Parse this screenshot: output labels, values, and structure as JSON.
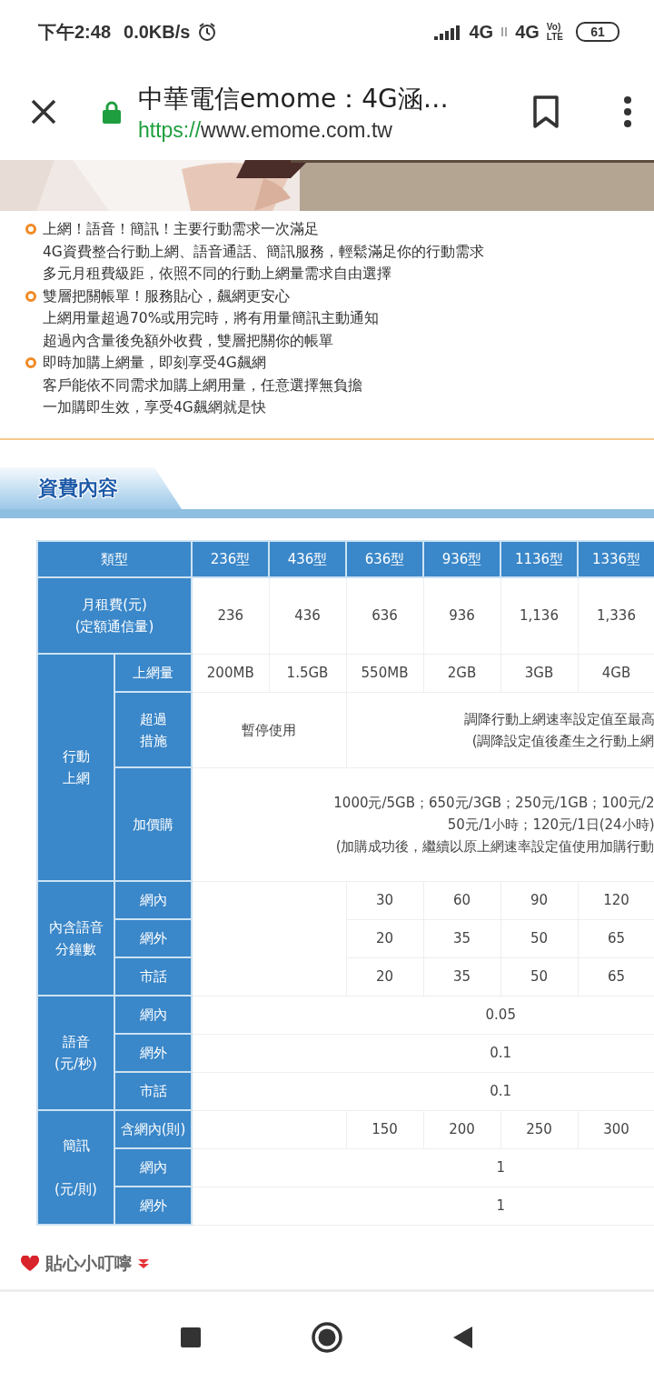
{
  "status_bar": {
    "time": "下午2:48",
    "speed": "0.0KB/s",
    "network_1": "4G",
    "network_2": "4G",
    "volte": [
      "Vo)",
      "LTE"
    ],
    "battery": "61"
  },
  "browser": {
    "title": "中華電信emome：4G涵…",
    "url_scheme": "https://",
    "url_host": "www.emome.com.tw"
  },
  "features": [
    {
      "title": "上網！語音！簡訊！主要行動需求一次滿足",
      "lines": [
        "4G資費整合行動上網、語音通話、簡訊服務，輕鬆滿足你的行動需求",
        "多元月租費級距，依照不同的行動上網量需求自由選擇"
      ]
    },
    {
      "title": "雙層把關帳單！服務貼心，飆網更安心",
      "lines": [
        "上網用量超過70%或用完時，將有用量簡訊主動通知",
        "超過內含量後免額外收費，雙層把關你的帳單"
      ]
    },
    {
      "title": "即時加購上網量，即刻享受4G飆網",
      "lines": [
        "客戶能依不同需求加購上網用量，任意選擇無負擔",
        "一加購即生效，享受4G飆網就是快"
      ]
    }
  ],
  "section_title": "資費內容",
  "table": {
    "rows": [
      [
        {
          "kind": "header",
          "text": "類型",
          "colspan": 2
        },
        {
          "kind": "header",
          "text": "236型"
        },
        {
          "kind": "header",
          "text": "436型"
        },
        {
          "kind": "header",
          "text": "636型"
        },
        {
          "kind": "header",
          "text": "936型"
        },
        {
          "kind": "header",
          "text": "1136型"
        },
        {
          "kind": "header",
          "text": "1336型"
        }
      ],
      [
        {
          "kind": "header",
          "text": "月租費(元)\n(定額通信量)",
          "colspan": 2
        },
        {
          "kind": "data",
          "text": "236"
        },
        {
          "kind": "data",
          "text": "436"
        },
        {
          "kind": "data",
          "text": "636"
        },
        {
          "kind": "data",
          "text": "936"
        },
        {
          "kind": "data",
          "text": "1,136"
        },
        {
          "kind": "data",
          "text": "1,336"
        }
      ],
      [
        {
          "kind": "header",
          "text": "行動上網",
          "rowspan": 3
        },
        {
          "kind": "header",
          "text": "上網量"
        },
        {
          "kind": "data",
          "text": "200MB"
        },
        {
          "kind": "data",
          "text": "1.5GB"
        },
        {
          "kind": "data",
          "text": "550MB"
        },
        {
          "kind": "data",
          "text": "2GB"
        },
        {
          "kind": "data",
          "text": "3GB"
        },
        {
          "kind": "data",
          "text": "4GB"
        }
      ],
      [
        {
          "kind": "header",
          "text": "超過措施"
        },
        {
          "kind": "data",
          "text": "暫停使用",
          "colspan": 2
        },
        {
          "kind": "cut",
          "text": "調降行動上網速率設定值至最高\n(調降設定值後產生之行動上網",
          "colspan": 4
        }
      ],
      [
        {
          "kind": "header",
          "text": "加價購"
        },
        {
          "kind": "cut",
          "text": "1000元/5GB；650元/3GB；250元/1GB；100元/2\n50元/1小時；120元/1日(24小時)\n(加購成功後，繼續以原上網速率設定值使用加購行動",
          "colspan": 6
        }
      ],
      [
        {
          "kind": "header",
          "text": "內含語音分鐘數",
          "rowspan": 3
        },
        {
          "kind": "header",
          "text": "網內"
        },
        {
          "kind": "blank",
          "colspan": 2,
          "rowspan": 3
        },
        {
          "kind": "data",
          "text": "30"
        },
        {
          "kind": "data",
          "text": "60"
        },
        {
          "kind": "data",
          "text": "90"
        },
        {
          "kind": "data",
          "text": "120"
        }
      ],
      [
        {
          "kind": "header",
          "text": "網外"
        },
        {
          "kind": "data",
          "text": "20"
        },
        {
          "kind": "data",
          "text": "35"
        },
        {
          "kind": "data",
          "text": "50"
        },
        {
          "kind": "data",
          "text": "65"
        }
      ],
      [
        {
          "kind": "header",
          "text": "市話"
        },
        {
          "kind": "data",
          "text": "20"
        },
        {
          "kind": "data",
          "text": "35"
        },
        {
          "kind": "data",
          "text": "50"
        },
        {
          "kind": "data",
          "text": "65"
        }
      ],
      [
        {
          "kind": "header",
          "text": "語音\n(元/秒)",
          "rowspan": 3
        },
        {
          "kind": "header",
          "text": "網內"
        },
        {
          "kind": "wide",
          "text": "0.05",
          "colspan": 6
        }
      ],
      [
        {
          "kind": "header",
          "text": "網外"
        },
        {
          "kind": "wide",
          "text": "0.1",
          "colspan": 6
        }
      ],
      [
        {
          "kind": "header",
          "text": "市話"
        },
        {
          "kind": "wide",
          "text": "0.1",
          "colspan": 6
        }
      ],
      [
        {
          "kind": "header",
          "text": "簡訊\n\n(元/則)",
          "rowspan": 3
        },
        {
          "kind": "header",
          "text": "含網內(則)"
        },
        {
          "kind": "blank",
          "colspan": 2
        },
        {
          "kind": "data",
          "text": "150"
        },
        {
          "kind": "data",
          "text": "200"
        },
        {
          "kind": "data",
          "text": "250"
        },
        {
          "kind": "data",
          "text": "300"
        }
      ],
      [
        {
          "kind": "header",
          "text": "網內"
        },
        {
          "kind": "wide",
          "text": "1",
          "colspan": 6
        }
      ],
      [
        {
          "kind": "header",
          "text": "網外"
        },
        {
          "kind": "wide",
          "text": "1",
          "colspan": 6
        }
      ]
    ]
  },
  "tip_title": "貼心小叮嚀"
}
